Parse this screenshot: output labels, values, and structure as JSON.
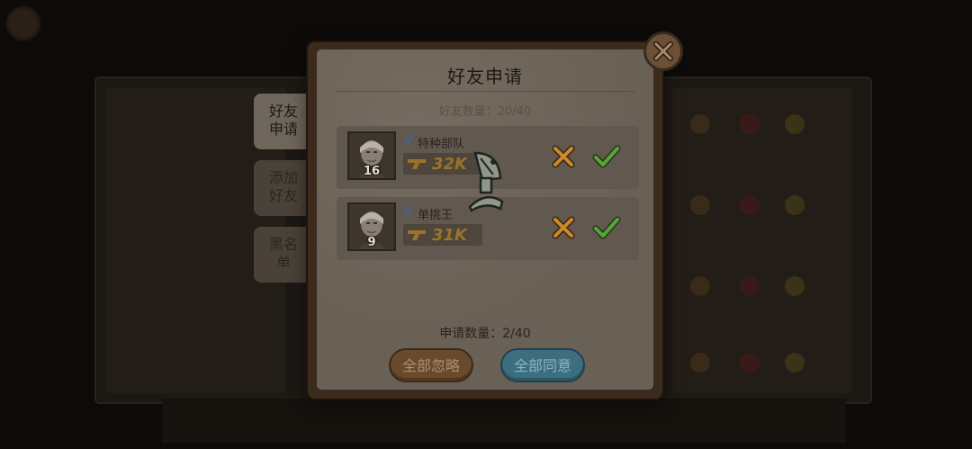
{
  "dialog": {
    "title": "好友申请",
    "friend_count": "好友数量：20/40",
    "apply_count": "申请数量：2/40"
  },
  "tabs": [
    {
      "label": "好友\n申请",
      "active": true
    },
    {
      "label": "添加\n好友",
      "active": false
    },
    {
      "label": "黑名\n单",
      "active": false
    }
  ],
  "requests": [
    {
      "name": "特种部队",
      "level": "16",
      "power": "32K",
      "gender": "male"
    },
    {
      "name": "单挑王",
      "level": "9",
      "power": "31K",
      "gender": "male"
    }
  ],
  "buttons": {
    "ignore_all": "全部忽略",
    "agree_all": "全部同意"
  },
  "colors": {
    "accept": "#5aa33c",
    "reject": "#c9892c",
    "power": "#9b7328"
  }
}
